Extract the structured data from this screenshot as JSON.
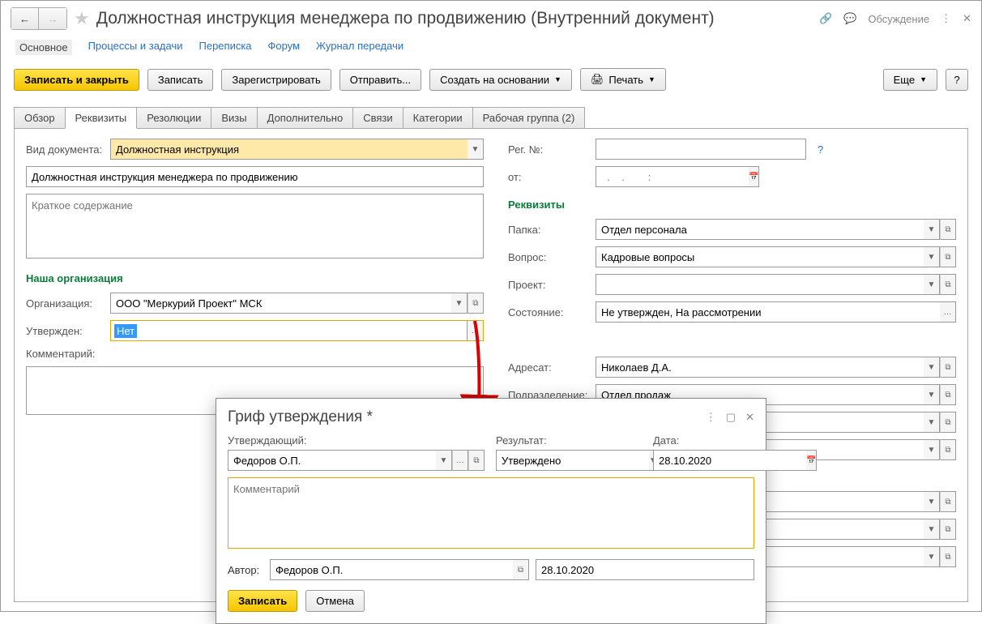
{
  "title": "Должностная инструкция менеджера по продвижению (Внутренний документ)",
  "discussion_label": "Обсуждение",
  "nav": {
    "main": "Основное",
    "processes": "Процессы и задачи",
    "correspondence": "Переписка",
    "forum": "Форум",
    "transfer_log": "Журнал передачи"
  },
  "toolbar": {
    "save_close": "Записать и закрыть",
    "save": "Записать",
    "register": "Зарегистрировать",
    "send": "Отправить...",
    "create_based": "Создать на основании",
    "print": "Печать",
    "more": "Еще",
    "help": "?"
  },
  "tabs": {
    "overview": "Обзор",
    "requisites": "Реквизиты",
    "resolutions": "Резолюции",
    "visas": "Визы",
    "additional": "Дополнительно",
    "links": "Связи",
    "categories": "Категории",
    "workgroup": "Рабочая группа (2)"
  },
  "form": {
    "doc_type_label": "Вид документа:",
    "doc_type_value": "Должностная инструкция",
    "name_value": "Должностная инструкция менеджера по продвижению",
    "summary_placeholder": "Краткое содержание",
    "our_org_section": "Наша организация",
    "org_label": "Организация:",
    "org_value": "ООО \"Меркурий Проект\" МСК",
    "approved_label": "Утвержден:",
    "approved_value": "Нет",
    "comment_label": "Комментарий:",
    "reg_no_label": "Рег. №:",
    "from_label": "от:",
    "date_placeholder": "  .    .        :",
    "requisites_section": "Реквизиты",
    "folder_label": "Папка:",
    "folder_value": "Отдел персонала",
    "question_label": "Вопрос:",
    "question_value": "Кадровые вопросы",
    "project_label": "Проект:",
    "state_label": "Состояние:",
    "state_value": "Не утвержден, На рассмотрении",
    "addressee_label": "Адресат:",
    "addressee_value": "Николаев Д.А.",
    "department_label": "Подразделение:",
    "department_value": "Отдел продаж"
  },
  "dialog": {
    "title": "Гриф утверждения *",
    "approver_label": "Утверждающий:",
    "approver_value": "Федоров О.П.",
    "result_label": "Результат:",
    "result_value": "Утверждено",
    "date_label": "Дата:",
    "date_value": "28.10.2020",
    "comment_placeholder": "Комментарий",
    "author_label": "Автор:",
    "author_value": "Федоров О.П.",
    "author_date": "28.10.2020",
    "save": "Записать",
    "cancel": "Отмена"
  }
}
